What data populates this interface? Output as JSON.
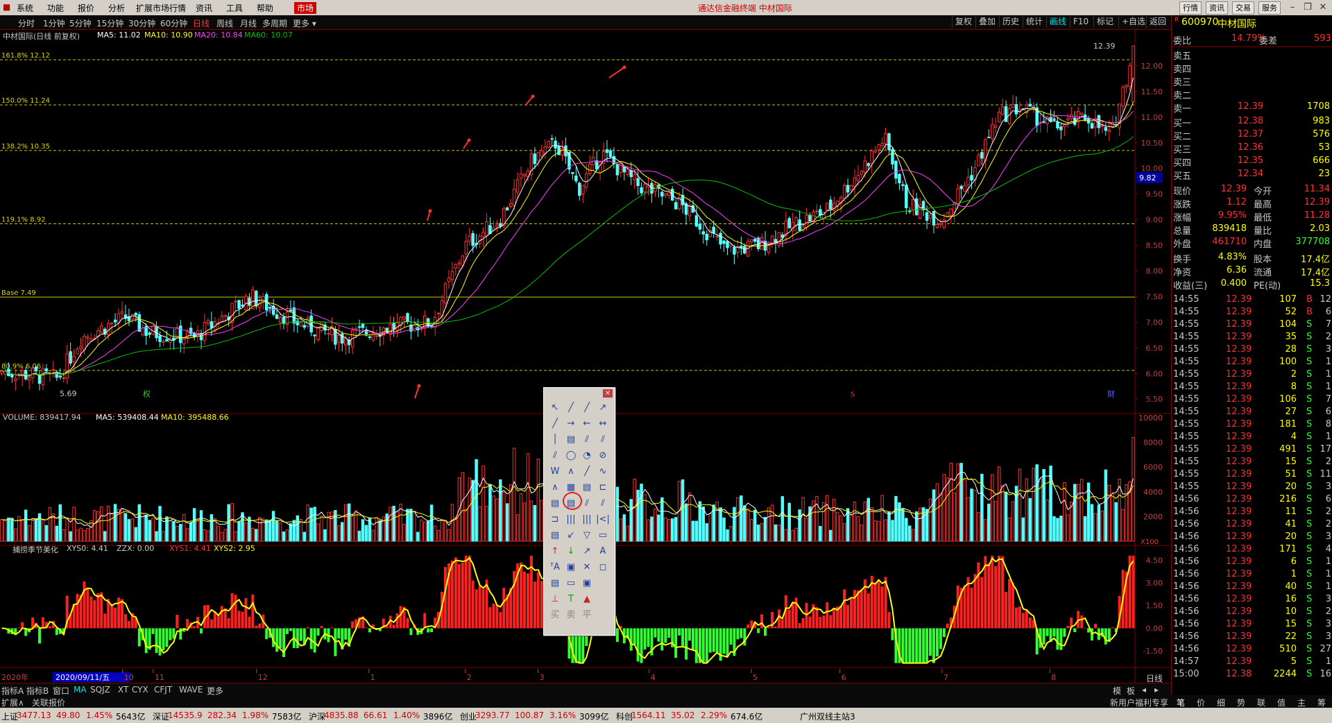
{
  "menubar": {
    "items": [
      "系统",
      "功能",
      "报价",
      "分析",
      "扩展市场行情",
      "资讯",
      "工具",
      "帮助"
    ],
    "market": "市场",
    "brand": "通达信金融终端  中材国际",
    "right_buttons": [
      "行情",
      "资讯",
      "交易",
      "服务"
    ]
  },
  "toolbar": {
    "periods": [
      "分时",
      "1分钟",
      "5分钟",
      "15分钟",
      "30分钟",
      "60分钟",
      "日线",
      "周线",
      "月线",
      "多周期",
      "更多 ▾"
    ],
    "active_period": "日线",
    "right_tools": [
      "复权",
      "叠加",
      "历史",
      "统计",
      "画线",
      "F10",
      "标记",
      "+自选",
      "返回"
    ]
  },
  "chart_header": {
    "name": "中材国际(日线 前复权)",
    "ma5": "MA5: 11.02",
    "ma10": "MA10: 10.90",
    "ma20": "MA20: 10.84",
    "ma60": "MA60: 10.07",
    "fib": [
      {
        "label": "161.8% 12.12",
        "price": 12.12
      },
      {
        "label": "150.0% 11.24",
        "price": 11.24
      },
      {
        "label": "138.2% 10.35",
        "price": 10.35
      },
      {
        "label": "119.1% 8.92",
        "price": 8.92
      },
      {
        "label": "Base 7.49",
        "price": 7.49
      },
      {
        "label": "80.9% 6.06",
        "price": 6.06
      }
    ],
    "high_label": "12.39",
    "low_label": "5.69",
    "cursor_price": "9.82",
    "markers": {
      "quan": "权",
      "cai": "财",
      "s": "S"
    }
  },
  "price_axis": [
    "12.00",
    "11.50",
    "11.00",
    "10.50",
    "10.00",
    "9.50",
    "9.00",
    "8.50",
    "8.00",
    "7.50",
    "7.00",
    "6.50",
    "6.00",
    "5.50"
  ],
  "volume_header": {
    "volume": "VOLUME: 839417.94",
    "ma5": "MA5: 539408.44",
    "ma10": "MA10: 395488.66"
  },
  "volume_axis": [
    "10000",
    "8000",
    "6000",
    "4000",
    "2000"
  ],
  "volume_unit": "X100",
  "indicator_header": {
    "name": "捕捞季节美化",
    "xys0": "XYS0: 4.41",
    "zzx": "ZZX: 0.00",
    "xys1": "XYS1: 4.41",
    "xys2": "XYS2: 2.95"
  },
  "indicator_axis": [
    "4.50",
    "3.00",
    "1.50",
    "0.00",
    "-1.50"
  ],
  "date_axis": {
    "year": "2020年",
    "cursor_date": "2020/09/11/五",
    "months": [
      {
        "label": "10",
        "pos": 0.108
      },
      {
        "label": "11",
        "pos": 0.135
      },
      {
        "label": "12",
        "pos": 0.226
      },
      {
        "label": "1",
        "pos": 0.325
      },
      {
        "label": "2",
        "pos": 0.41
      },
      {
        "label": "3",
        "pos": 0.474
      },
      {
        "label": "4",
        "pos": 0.572
      },
      {
        "label": "5",
        "pos": 0.662
      },
      {
        "label": "6",
        "pos": 0.74
      },
      {
        "label": "7",
        "pos": 0.83
      },
      {
        "label": "8",
        "pos": 0.925
      }
    ],
    "period_label": "日线"
  },
  "bottom_tabs": [
    "指标A",
    "指标B",
    "窗口",
    "MA",
    "SQJZ",
    "XT",
    "CYX",
    "CFJT",
    "WAVE",
    "更多"
  ],
  "bottom_tabs2": [
    "扩展∧",
    "关联报价"
  ],
  "bottom_right": [
    "模",
    "板"
  ],
  "news_label": "新用户福利专享",
  "quote": {
    "code": "600970",
    "name": "中材国际",
    "weibi_label": "委比",
    "weibi": "14.79%",
    "weicha_label": "委差",
    "weicha": "593",
    "sell": [
      {
        "label": "卖五",
        "price": "",
        "vol": ""
      },
      {
        "label": "卖四",
        "price": "",
        "vol": ""
      },
      {
        "label": "卖三",
        "price": "",
        "vol": ""
      },
      {
        "label": "卖二",
        "price": "",
        "vol": ""
      },
      {
        "label": "卖一",
        "price": "12.39",
        "vol": "1708"
      }
    ],
    "buy": [
      {
        "label": "买一",
        "price": "12.38",
        "vol": "983"
      },
      {
        "label": "买二",
        "price": "12.37",
        "vol": "576"
      },
      {
        "label": "买三",
        "price": "12.36",
        "vol": "53"
      },
      {
        "label": "买四",
        "price": "12.35",
        "vol": "666"
      },
      {
        "label": "买五",
        "price": "12.34",
        "vol": "23"
      }
    ],
    "stats": [
      {
        "l1": "现价",
        "v1": "12.39",
        "l2": "今开",
        "v2": "11.34"
      },
      {
        "l1": "涨跌",
        "v1": "1.12",
        "l2": "最高",
        "v2": "12.39"
      },
      {
        "l1": "涨幅",
        "v1": "9.95%",
        "l2": "最低",
        "v2": "11.28"
      },
      {
        "l1": "总量",
        "v1": "839418",
        "l2": "量比",
        "v2": "2.03"
      },
      {
        "l1": "外盘",
        "v1": "461710",
        "l2": "内盘",
        "v2": "377708"
      },
      {
        "l1": "换手",
        "v1": "4.83%",
        "l2": "股本",
        "v2": "17.4亿"
      },
      {
        "l1": "净资",
        "v1": "6.36",
        "l2": "流通",
        "v2": "17.4亿"
      },
      {
        "l1": "收益(三)",
        "v1": "0.400",
        "l2": "PE(动)",
        "v2": "15.3"
      }
    ],
    "ticks": [
      {
        "t": "14:55",
        "p": "12.39",
        "v": "107",
        "d": "B",
        "n": "12"
      },
      {
        "t": "14:55",
        "p": "12.39",
        "v": "52",
        "d": "B",
        "n": "6"
      },
      {
        "t": "14:55",
        "p": "12.39",
        "v": "104",
        "d": "S",
        "n": "7"
      },
      {
        "t": "14:55",
        "p": "12.39",
        "v": "35",
        "d": "S",
        "n": "2"
      },
      {
        "t": "14:55",
        "p": "12.39",
        "v": "28",
        "d": "S",
        "n": "3"
      },
      {
        "t": "14:55",
        "p": "12.39",
        "v": "100",
        "d": "S",
        "n": "1"
      },
      {
        "t": "14:55",
        "p": "12.39",
        "v": "2",
        "d": "S",
        "n": "1"
      },
      {
        "t": "14:55",
        "p": "12.39",
        "v": "8",
        "d": "S",
        "n": "1"
      },
      {
        "t": "14:55",
        "p": "12.39",
        "v": "106",
        "d": "S",
        "n": "7"
      },
      {
        "t": "14:55",
        "p": "12.39",
        "v": "27",
        "d": "S",
        "n": "6"
      },
      {
        "t": "14:55",
        "p": "12.39",
        "v": "181",
        "d": "S",
        "n": "8"
      },
      {
        "t": "14:55",
        "p": "12.39",
        "v": "4",
        "d": "S",
        "n": "1"
      },
      {
        "t": "14:55",
        "p": "12.39",
        "v": "491",
        "d": "S",
        "n": "17"
      },
      {
        "t": "14:55",
        "p": "12.39",
        "v": "15",
        "d": "S",
        "n": "2"
      },
      {
        "t": "14:55",
        "p": "12.39",
        "v": "51",
        "d": "S",
        "n": "11"
      },
      {
        "t": "14:55",
        "p": "12.39",
        "v": "20",
        "d": "S",
        "n": "3"
      },
      {
        "t": "14:56",
        "p": "12.39",
        "v": "216",
        "d": "S",
        "n": "6"
      },
      {
        "t": "14:56",
        "p": "12.39",
        "v": "11",
        "d": "S",
        "n": "2"
      },
      {
        "t": "14:56",
        "p": "12.39",
        "v": "41",
        "d": "S",
        "n": "2"
      },
      {
        "t": "14:56",
        "p": "12.39",
        "v": "20",
        "d": "S",
        "n": "3"
      },
      {
        "t": "14:56",
        "p": "12.39",
        "v": "171",
        "d": "S",
        "n": "4"
      },
      {
        "t": "14:56",
        "p": "12.39",
        "v": "6",
        "d": "S",
        "n": "1"
      },
      {
        "t": "14:56",
        "p": "12.39",
        "v": "1",
        "d": "S",
        "n": "1"
      },
      {
        "t": "14:56",
        "p": "12.39",
        "v": "40",
        "d": "S",
        "n": "1"
      },
      {
        "t": "14:56",
        "p": "12.39",
        "v": "16",
        "d": "S",
        "n": "3"
      },
      {
        "t": "14:56",
        "p": "12.39",
        "v": "10",
        "d": "S",
        "n": "2"
      },
      {
        "t": "14:56",
        "p": "12.39",
        "v": "15",
        "d": "S",
        "n": "3"
      },
      {
        "t": "14:56",
        "p": "12.39",
        "v": "22",
        "d": "S",
        "n": "3"
      },
      {
        "t": "14:56",
        "p": "12.39",
        "v": "510",
        "d": "S",
        "n": "27"
      },
      {
        "t": "14:57",
        "p": "12.39",
        "v": "5",
        "d": "S",
        "n": "1"
      },
      {
        "t": "15:00",
        "p": "12.38",
        "v": "2244",
        "d": "S",
        "n": "16"
      }
    ],
    "tabs": [
      "笔",
      "价",
      "细",
      "势",
      "联",
      "值",
      "主",
      "筹"
    ]
  },
  "status": [
    {
      "name": "上证",
      "val": "3477.13",
      "chg": "49.80",
      "pct": "1.45%",
      "amt": "5643亿"
    },
    {
      "name": "深证",
      "val": "14535.9",
      "chg": "282.34",
      "pct": "1.98%",
      "amt": "7583亿"
    },
    {
      "name": "沪深",
      "val": "4835.88",
      "chg": "66.61",
      "pct": "1.40%",
      "amt": "3896亿"
    },
    {
      "name": "创业",
      "val": "3293.77",
      "chg": "100.87",
      "pct": "3.16%",
      "amt": "3099亿"
    },
    {
      "name": "科创",
      "val": "1564.11",
      "chg": "35.02",
      "pct": "2.29%",
      "amt": "674.6亿"
    }
  ],
  "server": "广州双线主站3",
  "chart_data": {
    "type": "candlestick",
    "price_range": [
      5.3,
      12.5
    ],
    "volume_range": [
      0,
      10000
    ],
    "indicator_range": [
      -2.5,
      5.2
    ]
  },
  "colors": {
    "up": "#ff3030",
    "down": "#54ffff",
    "ma5": "#ffffff",
    "ma10": "#ffff00",
    "ma20": "#ff40ff",
    "ma60": "#00c000",
    "fib": "#c8c800"
  },
  "tool_palette": {
    "icons": [
      "cursor-icon",
      "line-icon",
      "ray-icon",
      "arrow-line-icon",
      "parallel-icon",
      "fib-icon",
      "circle-icon",
      "text-icon",
      "up-arrow-icon",
      "down-arrow-icon",
      "delete-icon"
    ]
  }
}
